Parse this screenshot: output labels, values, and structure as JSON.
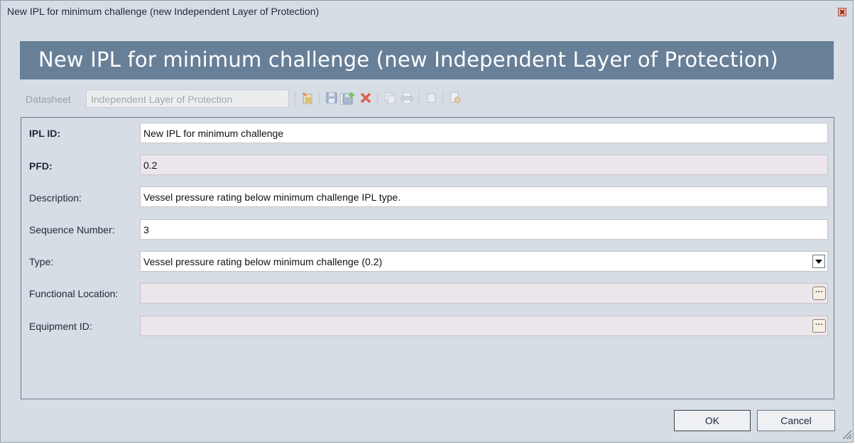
{
  "window": {
    "title": "New IPL for minimum challenge (new Independent Layer of Protection)"
  },
  "header": {
    "title": "New IPL for minimum challenge (new Independent Layer of Protection)",
    "color": "#687f98"
  },
  "toolbar": {
    "datasheet_label": "Datasheet",
    "datasheet_value": "Independent Layer of Protection",
    "icons": [
      "new-record-icon",
      "save-icon",
      "save-and-new-icon",
      "delete-icon",
      "copy-icon",
      "print-icon",
      "attachment-icon",
      "view-icon"
    ]
  },
  "form": {
    "fields": [
      {
        "label": "IPL ID:",
        "value": "New IPL for minimum challenge",
        "bold": true,
        "readonly": false
      },
      {
        "label": "PFD:",
        "value": "0.2",
        "bold": true,
        "readonly": true
      },
      {
        "label": "Description:",
        "value": "Vessel pressure rating below minimum challenge IPL type.",
        "bold": false,
        "readonly": false
      },
      {
        "label": "Sequence Number:",
        "value": "3",
        "bold": false,
        "readonly": false
      },
      {
        "label": "Type:",
        "value": "Vessel pressure rating below minimum challenge (0.2)",
        "bold": false,
        "readonly": false
      },
      {
        "label": "Functional Location:",
        "value": "",
        "bold": false,
        "readonly": true
      },
      {
        "label": "Equipment ID:",
        "value": "",
        "bold": false,
        "readonly": true
      }
    ]
  },
  "buttons": {
    "ok": "OK",
    "cancel": "Cancel"
  }
}
